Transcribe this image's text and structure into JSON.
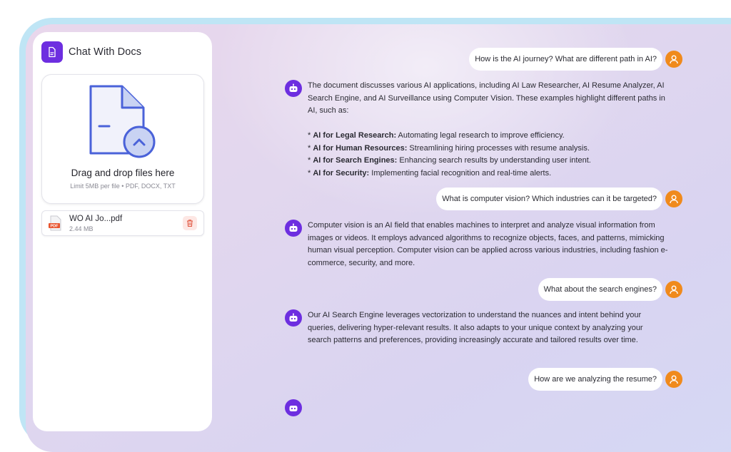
{
  "sidebar": {
    "brand": {
      "title": "Chat With Docs",
      "icon": "document-icon",
      "color": "#6d2ee0"
    },
    "dropzone": {
      "title": "Drag and drop files here",
      "subtitle": "Limit 5MB per file • PDF, DOCX, TXT",
      "icon": "file-upload-icon"
    },
    "files": [
      {
        "name": "WO AI Jo...pdf",
        "size": "2.44 MB",
        "type_badge": "PDF"
      }
    ]
  },
  "chat": {
    "messages": [
      {
        "role": "user",
        "text": "How is the AI journey? What are different path in AI?"
      },
      {
        "role": "bot",
        "intro": "The document discusses various AI applications, including AI Law Researcher, AI Resume Analyzer, AI Search Engine, and AI Surveillance using Computer Vision. These examples highlight different paths in AI, such as:",
        "bullets": [
          {
            "prefix": "* ",
            "term": "AI for Legal Research:",
            "desc": " Automating legal research to improve efficiency."
          },
          {
            "prefix": "* ",
            "term": "AI for Human Resources:",
            "desc": " Streamlining hiring processes with resume analysis."
          },
          {
            "prefix": "* ",
            "term": "AI for Search Engines:",
            "desc": " Enhancing search results by understanding user intent."
          },
          {
            "prefix": "* ",
            "term": "AI for Security:",
            "desc": " Implementing facial recognition and real-time alerts."
          }
        ]
      },
      {
        "role": "user",
        "text": "What is computer vision? Which industries can it be targeted?"
      },
      {
        "role": "bot",
        "intro": "Computer vision is an AI field that enables machines to interpret and analyze visual information from images or videos. It employs advanced algorithms to recognize objects, faces, and patterns, mimicking human visual perception. Computer vision can be applied across various industries, including fashion e-commerce, security, and more."
      },
      {
        "role": "user",
        "text": "What about the search engines?"
      },
      {
        "role": "bot",
        "intro": "Our AI Search Engine leverages vectorization to understand the nuances and intent behind your queries, delivering hyper-relevant results. It also adapts to your unique context by analyzing your search patterns and preferences, providing increasingly accurate and tailored results over time."
      },
      {
        "role": "user",
        "text": "How are we analyzing the resume?"
      }
    ],
    "user_avatar_color": "#f08a1c",
    "bot_avatar_color": "#6d2ee0"
  }
}
